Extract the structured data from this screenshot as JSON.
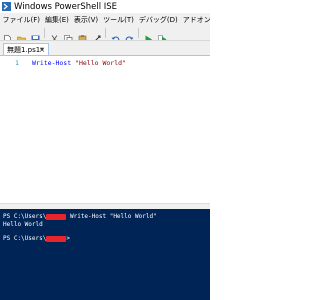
{
  "window": {
    "title": "Windows PowerShell ISE"
  },
  "menu": [
    "ファイル(F)",
    "編集(E)",
    "表示(V)",
    "ツール(T)",
    "デバッグ(D)",
    "アドオン(A)"
  ],
  "tab": {
    "label": "無題1.ps1*",
    "close": "×"
  },
  "editor": {
    "line_number": "1",
    "command": "Write-Host",
    "string": "\"Hello World\""
  },
  "console": {
    "line1_prefix": "PS C:\\Users\\",
    "line1_cmd": " Write-Host \"Hello World\"",
    "line2": "Hello World",
    "line3_prefix": "PS C:\\Users\\",
    "line3_suffix": ">"
  },
  "colors": {
    "console_bg": "#012456",
    "redaction": "#e8252a"
  }
}
